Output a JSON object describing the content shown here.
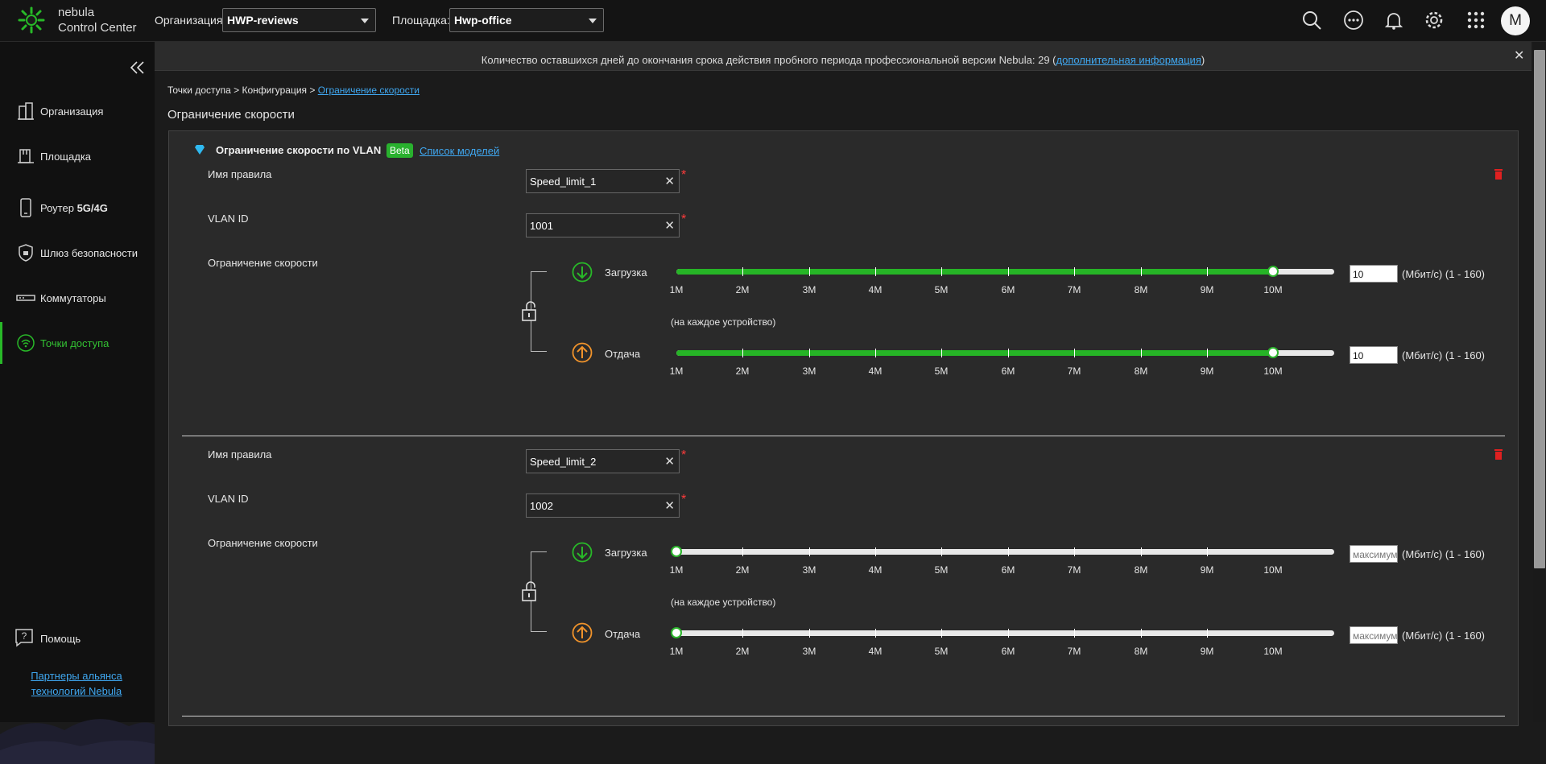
{
  "app": {
    "brand_line1": "nebula",
    "brand_line2": "Control Center"
  },
  "header": {
    "org_label": "Организация:",
    "org_value": "HWP-reviews",
    "site_label": "Площадка:",
    "site_value": "Hwp-office",
    "icons": [
      "search-icon",
      "more-icon",
      "bell-icon",
      "gear-icon",
      "apps-grid-icon"
    ],
    "avatar_letter": "M"
  },
  "sidebar": {
    "items": [
      {
        "label": "Организация",
        "icon": "building-icon"
      },
      {
        "label": "Площадка",
        "icon": "site-icon"
      },
      {
        "label": "Роутер 5G/4G",
        "icon": "phone-router-icon"
      },
      {
        "label": "Шлюз безопасности",
        "icon": "shield-icon"
      },
      {
        "label": "Коммутаторы",
        "icon": "switch-icon"
      },
      {
        "label": "Точки доступа",
        "icon": "wifi-ap-icon",
        "active": true
      }
    ],
    "help_label": "Помощь",
    "partners_line1": "Партнеры альянса",
    "partners_line2": "технологий Nebula"
  },
  "banner": {
    "text": "Количество оставшихся дней до окончания срока действия пробного периода профессиональной версии Nebula: 29 (",
    "link": "дополнительная информация",
    "tail": ")"
  },
  "breadcrumb": {
    "part1": "Точки доступа",
    "sep1": " > ",
    "part2": "Конфигурация",
    "sep2": " > ",
    "current": "Ограничение скорости"
  },
  "page_title": "Ограничение скорости",
  "section": {
    "title": "Ограничение скорости по VLAN",
    "badge": "Beta",
    "models_link": "Список моделей"
  },
  "labels": {
    "rule_name": "Имя правила",
    "vlan_id": "VLAN ID",
    "speed_limit": "Ограничение скорости",
    "download": "Загрузка",
    "upload": "Отдача",
    "per_device": "(на каждое устройство)",
    "unit": "(Мбит/с)   (1 - 160)",
    "required": "*",
    "clear": "✕"
  },
  "scale_ticks": [
    "1M",
    "2M",
    "3M",
    "4M",
    "5M",
    "6M",
    "7M",
    "8M",
    "9M",
    "10M"
  ],
  "rules": [
    {
      "name": "Speed_limit_1",
      "vlan": "1001",
      "download_value": "10",
      "upload_value": "10",
      "download_level": 10,
      "upload_level": 10
    },
    {
      "name": "Speed_limit_2",
      "vlan": "1002",
      "download_placeholder": "максимум",
      "upload_placeholder": "максимум",
      "download_level": 1,
      "upload_level": 1
    }
  ],
  "colors": {
    "accent": "#28b928",
    "link": "#3fa7f0",
    "download": "#28b928",
    "upload": "#f0932b",
    "danger": "#e02020"
  }
}
